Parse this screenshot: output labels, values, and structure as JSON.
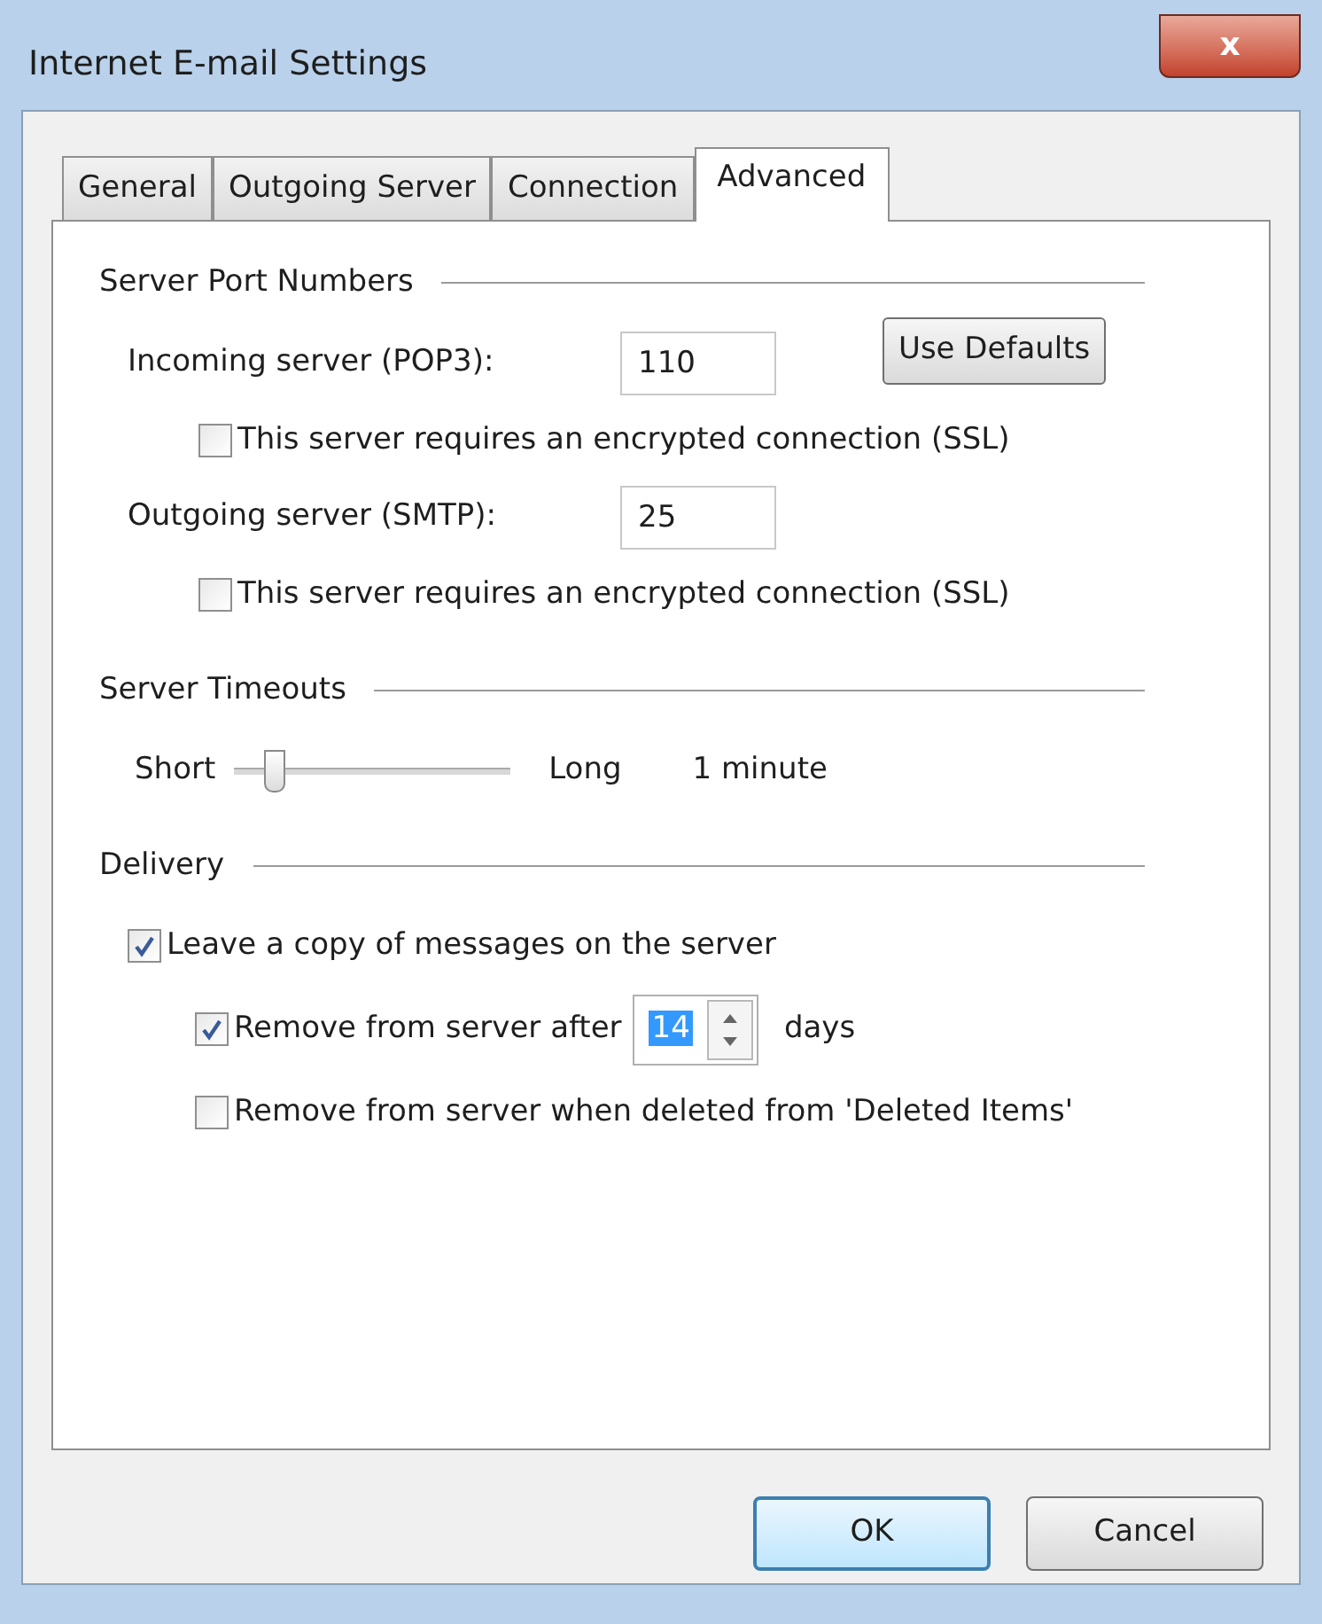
{
  "window": {
    "title": "Internet E-mail Settings",
    "close": "x"
  },
  "tabs": [
    {
      "label": "General",
      "selected": false
    },
    {
      "label": "Outgoing Server",
      "selected": false
    },
    {
      "label": "Connection",
      "selected": false
    },
    {
      "label": "Advanced",
      "selected": true
    }
  ],
  "server_port_numbers": {
    "title": "Server Port Numbers",
    "incoming": {
      "label": "Incoming server (POP3):",
      "value": "110"
    },
    "incoming_ssl": {
      "label": "This server requires an encrypted connection (SSL)",
      "checked": false
    },
    "use_defaults": "Use Defaults",
    "outgoing": {
      "label": "Outgoing server (SMTP):",
      "value": "25"
    },
    "outgoing_ssl": {
      "label": "This server requires an encrypted connection (SSL)",
      "checked": false
    }
  },
  "server_timeouts": {
    "title": "Server Timeouts",
    "min_label": "Short",
    "max_label": "Long",
    "level": 0.12,
    "reading": "1 minute"
  },
  "delivery": {
    "title": "Delivery",
    "leave_copy": {
      "label": "Leave a copy of messages on the server",
      "checked": true
    },
    "remove_after": {
      "label": "Remove from server after",
      "checked": true,
      "value": "14",
      "unit": "days"
    },
    "remove_deleted": {
      "label": "Remove from server when deleted from 'Deleted Items'",
      "checked": false
    }
  },
  "buttons": [
    {
      "label": "OK",
      "default": true
    },
    {
      "label": "Cancel",
      "default": false
    }
  ]
}
